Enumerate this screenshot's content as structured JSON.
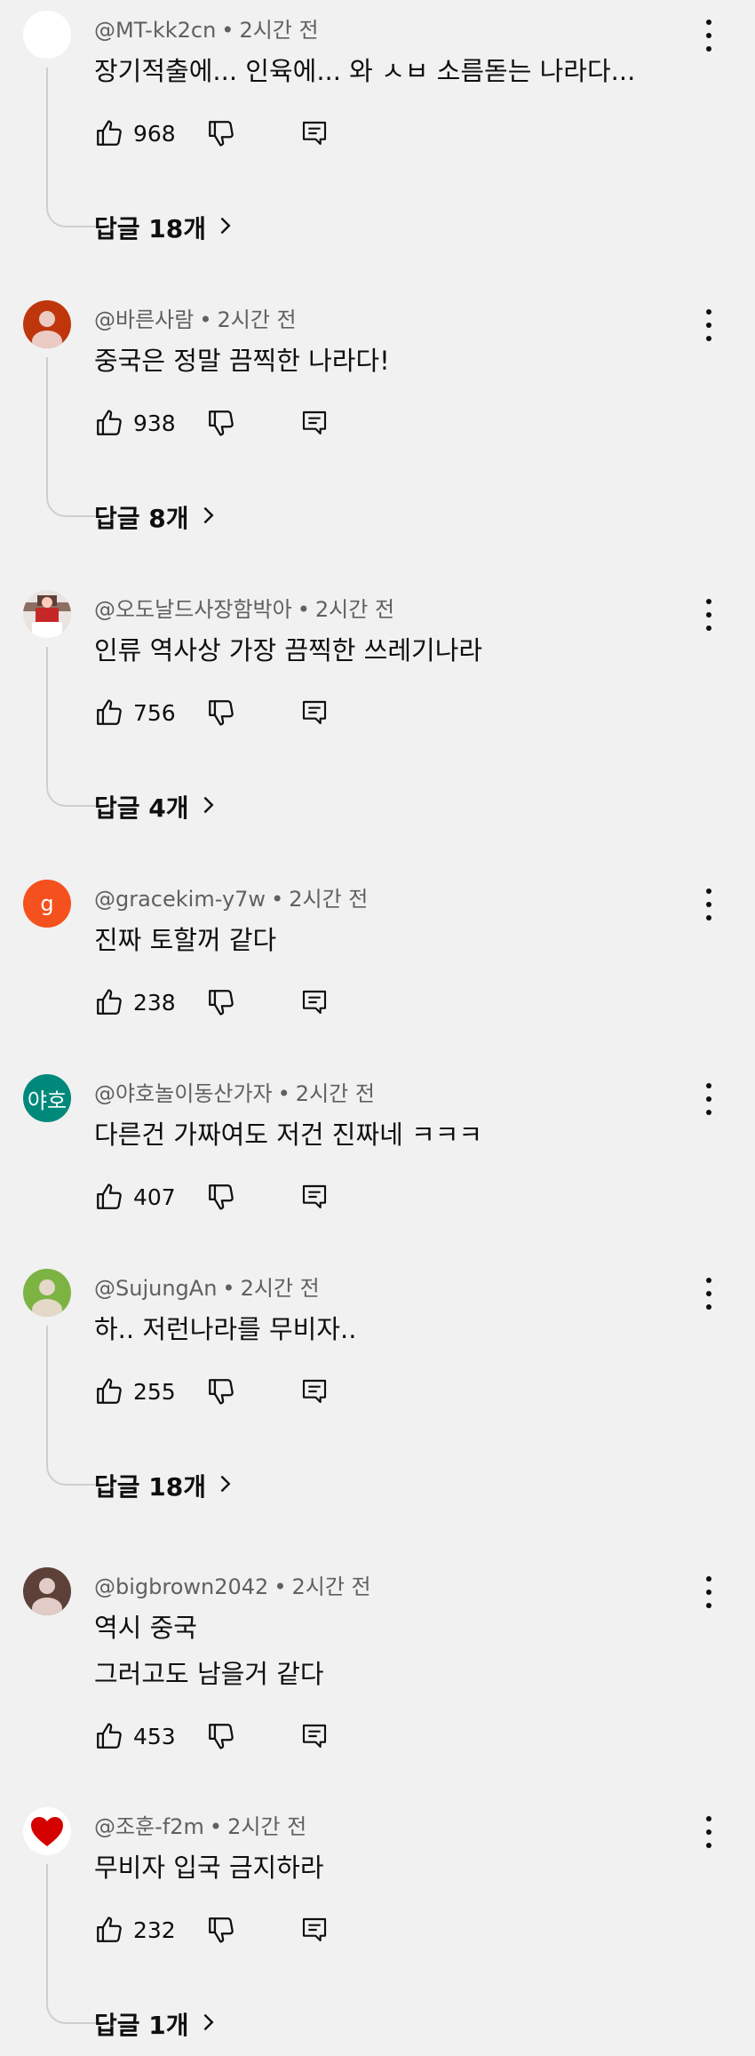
{
  "comments": [
    {
      "author": "@MT-kk2cn",
      "time": "2시간 전",
      "lines": [
        "장기적출에... 인육에... 와 ㅅㅂ 소름돋는 나라다..."
      ],
      "likes": "968",
      "replies": "답글 18개",
      "avatar": {
        "kind": "blank",
        "color": "#ffffff"
      }
    },
    {
      "author": "@바른사람",
      "time": "2시간 전",
      "lines": [
        "중국은 정말 끔찍한 나라다!"
      ],
      "likes": "938",
      "replies": "답글 8개",
      "avatar": {
        "kind": "person",
        "color": "#bf360c"
      }
    },
    {
      "author": "@오도날드사장함박아",
      "time": "2시간 전",
      "lines": [
        "인류 역사상 가장 끔찍한 쓰레기나라"
      ],
      "likes": "756",
      "replies": "답글 4개",
      "avatar": {
        "kind": "photo",
        "color": "#d8d8d8"
      }
    },
    {
      "author": "@gracekim-y7w",
      "time": "2시간 전",
      "lines": [
        "진짜 토할꺼 같다"
      ],
      "likes": "238",
      "replies": "",
      "avatar": {
        "kind": "letter",
        "color": "#f4511e",
        "letter": "g"
      }
    },
    {
      "author": "@야호놀이동산가자",
      "time": "2시간 전",
      "lines": [
        "다른건 가짜여도 저건 진짜네 ㅋㅋㅋ"
      ],
      "likes": "407",
      "replies": "",
      "avatar": {
        "kind": "letter",
        "color": "#00897b",
        "letter": "야호"
      }
    },
    {
      "author": "@SujungAn",
      "time": "2시간 전",
      "lines": [
        "하.. 저런나라를  무비자.."
      ],
      "likes": "255",
      "replies": "답글 18개",
      "avatar": {
        "kind": "person",
        "color": "#7cb342"
      }
    },
    {
      "author": "@bigbrown2042",
      "time": "2시간 전",
      "lines": [
        "역시 중국",
        "그러고도 남을거 같다"
      ],
      "likes": "453",
      "replies": "",
      "avatar": {
        "kind": "person",
        "color": "#5d4037"
      }
    },
    {
      "author": "@조훈-f2m",
      "time": "2시간 전",
      "lines": [
        "무비자 입국 금지하라"
      ],
      "likes": "232",
      "replies": "답글 1개",
      "avatar": {
        "kind": "heart",
        "color": "#ffffff"
      }
    }
  ],
  "icons": {
    "like": "thumbs-up-icon",
    "dislike": "thumbs-down-icon",
    "reply": "reply-icon",
    "more": "more-vert-icon",
    "chevron": "chevron-right-icon"
  }
}
